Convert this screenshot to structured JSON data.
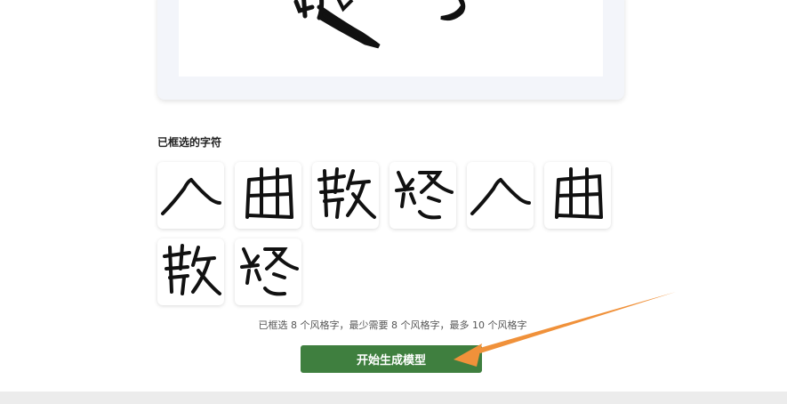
{
  "selected_section": {
    "title": "已框选的字符",
    "characters": [
      "人",
      "曲",
      "散",
      "終",
      "人",
      "曲",
      "散",
      "終"
    ]
  },
  "status": {
    "message": "已框选 8 个风格字，最少需要 8 个风格字，最多 10 个风格字"
  },
  "actions": {
    "start_button_label": "开始生成模型"
  },
  "colors": {
    "button_bg": "#3f7f3f",
    "arrow": "#f0913a"
  }
}
